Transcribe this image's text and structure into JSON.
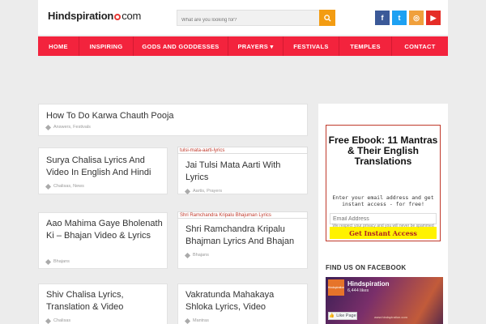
{
  "header": {
    "logo_main": "Hindspiration",
    "logo_tld": "com",
    "search_placeholder": "What are you looking for?",
    "social": [
      {
        "icon": "facebook-icon",
        "glyph": "f",
        "color": "#3b5998"
      },
      {
        "icon": "twitter-icon",
        "glyph": "t",
        "color": "#1da1f2"
      },
      {
        "icon": "instagram-icon",
        "glyph": "◎",
        "color": "#f0a03c"
      },
      {
        "icon": "youtube-icon",
        "glyph": "▶",
        "color": "#e52d27"
      }
    ]
  },
  "nav": {
    "items": [
      {
        "label": "Home"
      },
      {
        "label": "Inspiring"
      },
      {
        "label": "Gods and Goddesses"
      },
      {
        "label": "Prayers ▾"
      },
      {
        "label": "Festivals"
      },
      {
        "label": "Temples"
      },
      {
        "label": "Contact"
      }
    ]
  },
  "posts": [
    {
      "title": "How To Do Karwa Chauth Pooja",
      "tags": "Answers, Festivals",
      "slug": ""
    },
    {
      "title": "Surya Chalisa Lyrics And Video In English And Hindi",
      "tags": "Chalisas, News",
      "slug": ""
    },
    {
      "title": "Jai Tulsi Mata Aarti With Lyrics",
      "tags": "Aartis, Prayers",
      "slug": "tulsi-mata-aarti-lyrics"
    },
    {
      "title": "Aao Mahima Gaye Bholenath Ki – Bhajan Video & Lyrics",
      "tags": "Bhajans",
      "slug": ""
    },
    {
      "title": "Shri Ramchandra Kripalu Bhajman Lyrics And Bhajan",
      "tags": "Bhajans",
      "slug": "Shri Ramchandra Kripalu Bhajuman Lyrics"
    },
    {
      "title": "Shiv Chalisa Lyrics, Translation & Video",
      "tags": "Chalisas",
      "slug": ""
    },
    {
      "title": "Vakratunda Mahakaya Shloka Lyrics, Video",
      "tags": "Mantras",
      "slug": ""
    }
  ],
  "sidebar": {
    "ebook_title": "Free Ebook: 11 Mantras & Their English Translations",
    "ebook_sub": "Enter your email address and get instant access - for free!",
    "email_placeholder": "Email Address",
    "cta_label": "Get Instant Access",
    "privacy": "We respect your privacy and you will never be spammed"
  },
  "facebook": {
    "heading": "Find us on Facebook",
    "page_name": "Hindspiration",
    "likes": "6,444 likes",
    "like_label": "Like Page",
    "thumb_text": "Hindspiration",
    "watermark": "www.hindspiration.com"
  }
}
